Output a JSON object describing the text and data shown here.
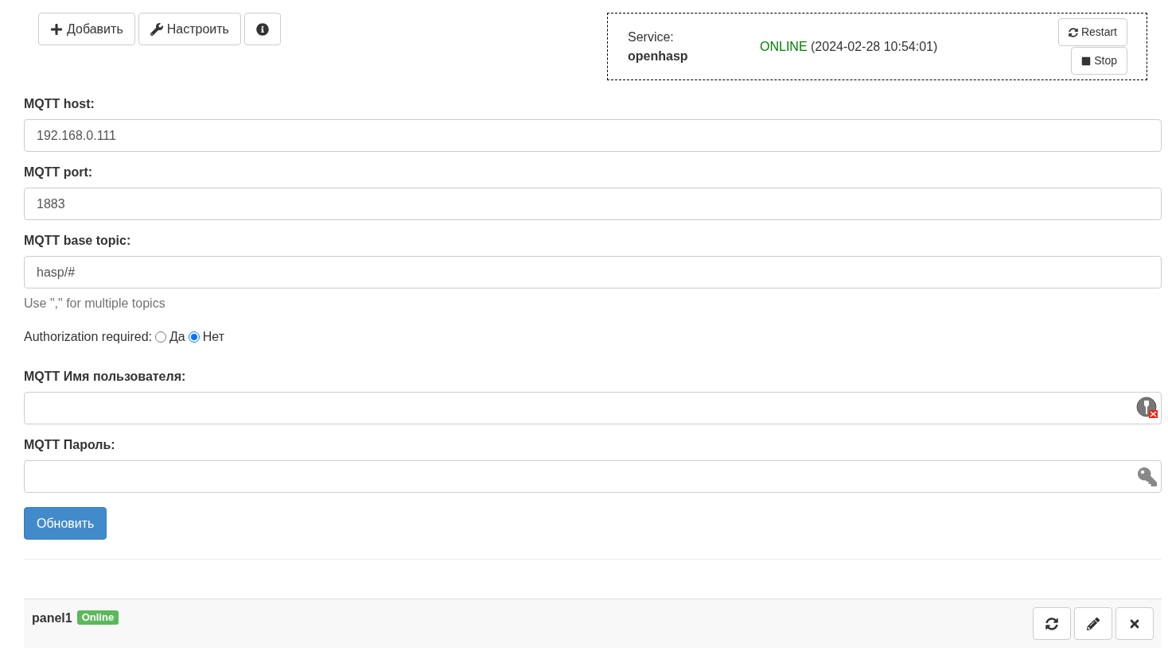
{
  "toolbar": [
    {
      "kind": "add",
      "label": "Добавить"
    },
    {
      "kind": "configure",
      "label": "Настроить"
    },
    {
      "kind": "info"
    }
  ],
  "service": {
    "label": "Service:",
    "name": "openhasp",
    "status": "ONLINE",
    "time": "(2024-02-28 10:54:01)",
    "online": true,
    "buttons": [
      {
        "kind": "restart",
        "label": "Restart"
      },
      {
        "kind": "stop",
        "label": "Stop"
      }
    ]
  },
  "fields_top": [
    {
      "label": "MQTT host:",
      "value": "192.168.0.111"
    },
    {
      "label": "MQTT port:",
      "value": "1883"
    },
    {
      "label": "MQTT base topic:",
      "value": "hasp/#",
      "help": "Use \",\" for multiple topics"
    }
  ],
  "auth": {
    "label": "Authorization required:",
    "options": [
      {
        "label": "Да",
        "selected": false
      },
      {
        "label": "Нет",
        "selected": true
      }
    ]
  },
  "fields_bottom": [
    {
      "label": "MQTT Имя пользователя:",
      "kind": "user"
    },
    {
      "label": "MQTT Пароль:",
      "kind": "password"
    }
  ],
  "submit": "Обновить",
  "devices": [
    {
      "name": "panel1",
      "badge": "Online",
      "online": true,
      "actions": [
        {
          "kind": "refresh"
        },
        {
          "kind": "edit"
        },
        {
          "kind": "delete"
        }
      ]
    }
  ]
}
